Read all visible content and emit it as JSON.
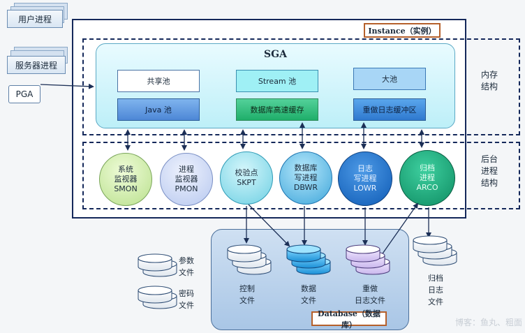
{
  "processes": {
    "user_process": "用户进程",
    "server_process": "服务器进程"
  },
  "pga": "PGA",
  "instance_label": "Instance（实例）",
  "database_label": "Database（数据库）",
  "sga": {
    "title": "SGA",
    "pools": {
      "shared_pool": "共享池",
      "stream_pool": "Stream 池",
      "large_pool": "大池",
      "java_pool": "Java 池",
      "db_buffer_cache": "数据库高速缓存",
      "redo_log_buffer": "重做日志缓冲区"
    }
  },
  "side_labels": {
    "memory": [
      "内存",
      "结构"
    ],
    "background": [
      "后台",
      "进程",
      "结构"
    ]
  },
  "bg_processes": [
    {
      "lines": [
        "系统",
        "监视器",
        "SMON"
      ]
    },
    {
      "lines": [
        "进程",
        "监视器",
        "PMON"
      ]
    },
    {
      "lines": [
        "校验点",
        "SKPT"
      ]
    },
    {
      "lines": [
        "数据库",
        "写进程",
        "DBWR"
      ]
    },
    {
      "lines": [
        "日志",
        "写进程",
        "LOWR"
      ]
    },
    {
      "lines": [
        "归档",
        "进程",
        "ARCO"
      ]
    }
  ],
  "files": {
    "param": [
      "参数",
      "文件"
    ],
    "password": [
      "密码",
      "文件"
    ],
    "control": [
      "控制",
      "文件"
    ],
    "data": [
      "数据",
      "文件"
    ],
    "redo": [
      "重做",
      "日志文件"
    ],
    "archive": [
      "归档",
      "日志",
      "文件"
    ]
  },
  "watermark": "博客：鱼丸、粗面",
  "colors": {
    "frame": "#14285a",
    "accent": "#b5602b",
    "arrow": "#1c2f56"
  }
}
